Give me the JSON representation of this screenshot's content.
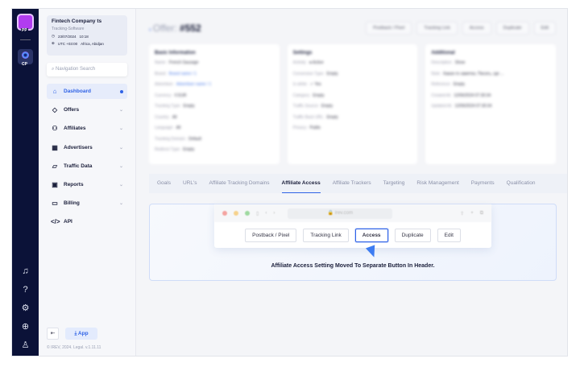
{
  "rail": {
    "logo": "PP",
    "cp": "CP",
    "icons": [
      "bell-icon",
      "help-icon",
      "settings-icon",
      "globe-icon",
      "user-icon"
    ]
  },
  "company": {
    "name": "Fintech Company ts",
    "subtitle": "Tracking-Software",
    "date": "23/07/2024",
    "time": "10:18",
    "timezone": "UTC +03:00",
    "city": "Africa, Abidjan"
  },
  "search": {
    "placeholder": "Navigation Search"
  },
  "nav": [
    {
      "label": "Dashboard",
      "icon": "⌂",
      "active": true
    },
    {
      "label": "Offers",
      "icon": "◇"
    },
    {
      "label": "Affiliates",
      "icon": "⚇"
    },
    {
      "label": "Advertisers",
      "icon": "▦"
    },
    {
      "label": "Traffic Data",
      "icon": "▱"
    },
    {
      "label": "Reports",
      "icon": "▣"
    },
    {
      "label": "Billing",
      "icon": "▭"
    },
    {
      "label": "API",
      "icon": "</>"
    }
  ],
  "footer": {
    "app": "App",
    "copyright": "© IREV, 2024. Legal. v.1.11.11"
  },
  "header": {
    "title_prefix": "Offer:",
    "offer_id": "#552",
    "buttons": [
      "Postback / Pixel",
      "Tracking Link",
      "Access",
      "Duplicate",
      "Edit"
    ]
  },
  "cards": [
    {
      "title": "Basic Information",
      "rows": [
        [
          "Name:",
          "French Sausage"
        ],
        [
          "Brand:",
          "Brand name / 1"
        ],
        [
          "Advertiser:",
          "Advertiser name / 1"
        ],
        [
          "Currency:",
          "€ EUR"
        ],
        [
          "Tracking Type:",
          "Empty"
        ],
        [
          "Country:",
          "All"
        ],
        [
          "Language:",
          "All"
        ],
        [
          "Tracking Domain:",
          "Default"
        ],
        [
          "Redirect Type:",
          "Empty"
        ]
      ]
    },
    {
      "title": "Settings",
      "rows": [
        [
          "Activity:",
          "● Active"
        ],
        [
          "Conversion Type:",
          "Empty"
        ],
        [
          "Is white:",
          "✓ Yes"
        ],
        [
          "Category:",
          "Empty"
        ],
        [
          "Traffic Source:",
          "Empty"
        ],
        [
          "Traffic Back URL:",
          "Empty"
        ],
        [
          "Privacy:",
          "Public"
        ]
      ]
    },
    {
      "title": "Additional",
      "rows": [
        [
          "Description:",
          "Show"
        ],
        [
          "Note:",
          "Какая-то заметка. Писать, где ..."
        ],
        [
          "Reference:",
          "Empty"
        ],
        [
          "Created At:",
          "12/06/2024 07:30:34"
        ],
        [
          "Updated At:",
          "12/06/2024 07:30:34"
        ]
      ]
    }
  ],
  "tabs": [
    "Goals",
    "URL's",
    "Affiliate Tracking Domains",
    "Affiliate Access",
    "Affiliate Trackers",
    "Targeting",
    "Risk Management",
    "Payments",
    "Qualification"
  ],
  "active_tab": "Affiliate Access",
  "panel": {
    "url": "irev.com",
    "buttons": [
      "Postback / Pixel",
      "Tracking Link",
      "Access",
      "Duplicate",
      "Edit"
    ],
    "selected": "Access",
    "message": "Affiliate Access Setting Moved To Separate Button In Header."
  },
  "colors": {
    "accent": "#2f62e6",
    "rail": "#0b1238"
  }
}
